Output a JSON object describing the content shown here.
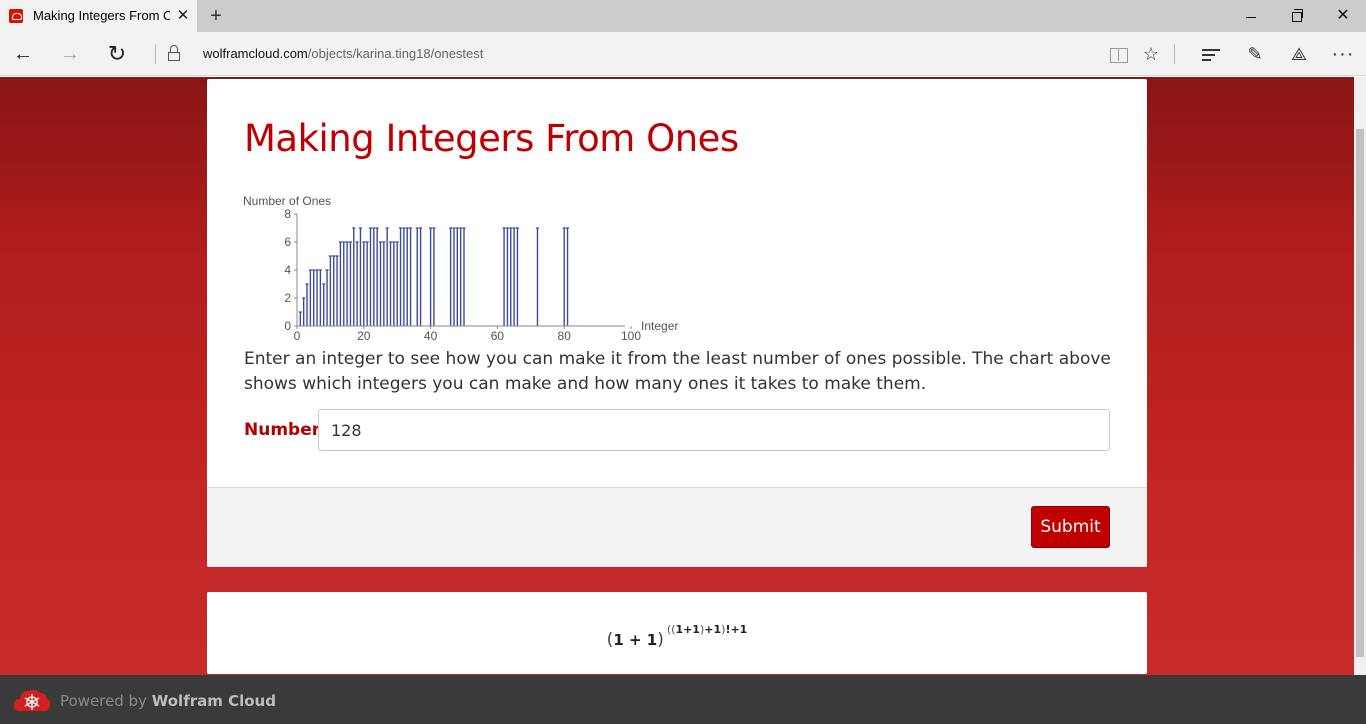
{
  "browser": {
    "tab_title": "Making Integers From Ones",
    "close_tab": "✕",
    "new_tab": "+",
    "window_close": "✕",
    "back_symbol": "←",
    "forward_symbol": "→",
    "refresh_symbol": "↻",
    "favorite_symbol": "☆",
    "web_note_symbol": "✎",
    "share_symbol": "⟁",
    "more_symbol": "···",
    "url_domain": "wolframcloud.com",
    "url_path": "/objects/karina.ting18/onestest"
  },
  "page": {
    "title": "Making Integers From Ones",
    "description": "Enter an integer to see how you can make it from the least number of ones possible. The chart above shows which integers you can make and how many ones it takes to make them.",
    "number_label": "Number",
    "number_value": "128",
    "submit_label": "Submit"
  },
  "result": {
    "base_open": "(",
    "base": "1 + 1",
    "base_close": ")",
    "exp_open1": "(",
    "exp_open2": "(",
    "exp_inner": "1+1",
    "exp_close2": ")",
    "exp_mid": "+1",
    "exp_close1": ")",
    "exp_tail": "!+1"
  },
  "footer": {
    "powered_by": "Powered by",
    "brand": "Wolfram Cloud"
  },
  "chart_data": {
    "type": "bar",
    "style": "stem",
    "ylabel": "Number of Ones",
    "xlabel": "Integer",
    "xlim": [
      0,
      100
    ],
    "ylim": [
      0,
      8
    ],
    "xticks": [
      0,
      20,
      40,
      60,
      80,
      100
    ],
    "yticks": [
      0,
      2,
      4,
      6,
      8
    ],
    "bar_color": "#3a4aa0",
    "x": [
      1,
      2,
      3,
      4,
      5,
      6,
      7,
      8,
      9,
      10,
      11,
      12,
      13,
      14,
      15,
      16,
      17,
      18,
      19,
      20,
      21,
      22,
      23,
      24,
      25,
      26,
      27,
      28,
      29,
      30,
      31,
      32,
      33,
      34,
      36,
      37,
      40,
      41,
      46,
      47,
      48,
      49,
      50,
      62,
      63,
      64,
      65,
      66,
      72,
      80,
      81
    ],
    "values": [
      1,
      2,
      3,
      4,
      4,
      4,
      4,
      3,
      4,
      5,
      5,
      5,
      6,
      6,
      6,
      6,
      7,
      6,
      7,
      6,
      6,
      7,
      7,
      7,
      6,
      6,
      7,
      6,
      6,
      6,
      7,
      7,
      7,
      7,
      7,
      7,
      7,
      7,
      7,
      7,
      7,
      7,
      7,
      7,
      7,
      7,
      7,
      7,
      7,
      7,
      7
    ]
  }
}
